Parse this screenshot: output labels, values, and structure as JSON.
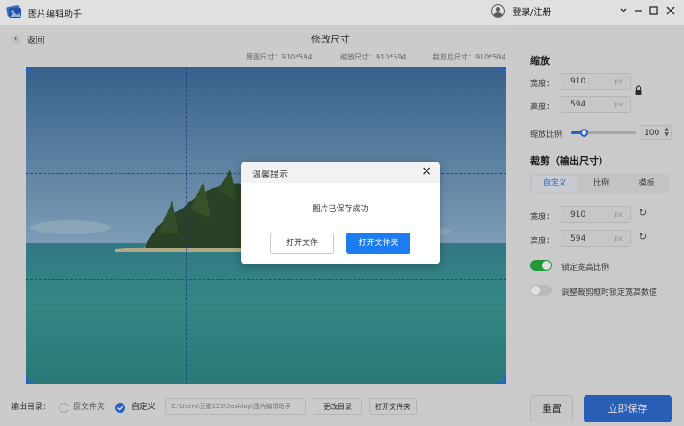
{
  "window": {
    "title": "图片编辑助手",
    "user_label": "登录/注册",
    "help_icon": "help-icon",
    "minimize_icon": "minimize-icon",
    "maximize_icon": "maximize-icon",
    "close_icon": "close-icon"
  },
  "header": {
    "back_label": "返回",
    "page_title": "修改尺寸",
    "original_size": "原图尺寸：910*594",
    "scaled_size": "缩放尺寸：910*594",
    "cropped_size": "裁剪后尺寸：910*594"
  },
  "scale": {
    "title": "缩放",
    "width_label": "宽度：",
    "width_value": "910",
    "height_label": "高度：",
    "height_value": "594",
    "unit": "px",
    "ratio_label": "缩放比例",
    "ratio_value": "100",
    "ratio_fraction": 0.2
  },
  "crop": {
    "title": "裁剪（输出尺寸）",
    "tabs": [
      "自定义",
      "比例",
      "模板"
    ],
    "active_tab": 0,
    "width_label": "宽度：",
    "width_value": "910",
    "height_label": "高度：",
    "height_value": "594",
    "unit": "px",
    "lock_ratio_label": "锁定宽高比例",
    "lock_ratio_on": true,
    "adjust_lock_label": "调整裁剪框时锁定宽高数值",
    "adjust_lock_on": false
  },
  "actions": {
    "reset_label": "重置",
    "save_label": "立即保存"
  },
  "output": {
    "label": "输出目录：",
    "option_source": "原文件夹",
    "option_custom": "自定义",
    "selected": "custom",
    "path": "C:\\Users\\豆瓣123\\Desktop\\图片编辑助手",
    "change_dir_label": "更改目录",
    "open_folder_label": "打开文件夹"
  },
  "dialog": {
    "title": "温馨提示",
    "message": "图片已保存成功",
    "open_file_label": "打开文件",
    "open_folder_label": "打开文件夹"
  },
  "colors": {
    "accent": "#2b6fe6",
    "primary_button": "#1c7cf2",
    "toggle_on": "#27ae3f"
  }
}
